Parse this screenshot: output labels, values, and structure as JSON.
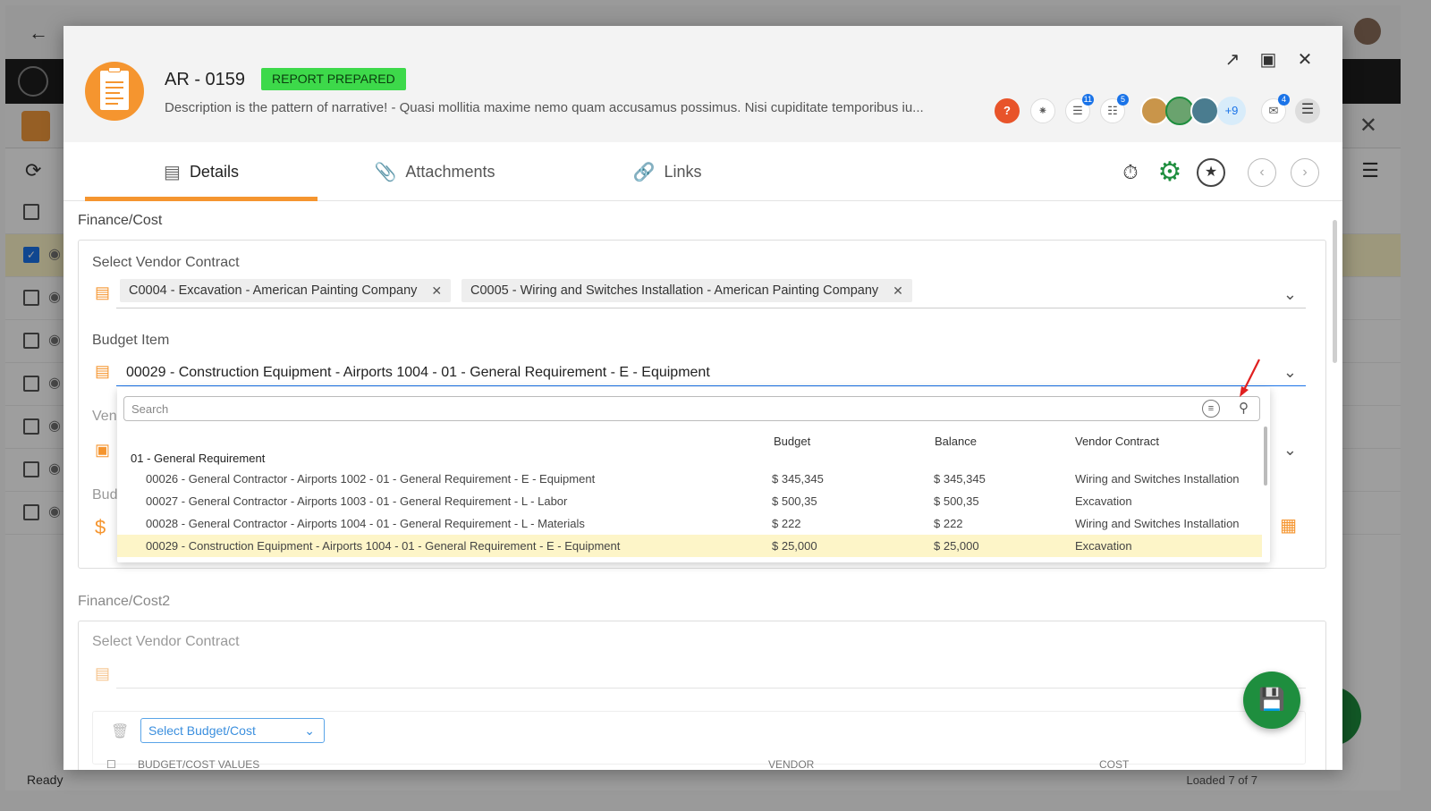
{
  "background": {
    "status": "Ready",
    "loaded": "Loaded 7 of 7"
  },
  "modal": {
    "record_id": "AR - 0159",
    "status_badge": "REPORT PREPARED",
    "description": "Description is the pattern of narrative!  - Quasi mollitia maxime nemo quam accusamus possimus. Nisi cupiditate temporibus iu...",
    "header_icons": {
      "help": "?",
      "notes_badge": "11",
      "tasks_badge": "5",
      "comments_badge": "4",
      "more_users": "+9"
    },
    "tabs": [
      {
        "label": "Details",
        "icon": "details-icon"
      },
      {
        "label": "Attachments",
        "icon": "paperclip-icon"
      },
      {
        "label": "Links",
        "icon": "link-icon"
      }
    ]
  },
  "finance": {
    "title": "Finance/Cost",
    "vendor_contract_label": "Select Vendor Contract",
    "chips": [
      "C0004 - Excavation - American Painting Company",
      "C0005 - Wiring and Switches Installation - American Painting Company"
    ],
    "budget_item_label": "Budget Item",
    "budget_item_value": "00029 - Construction Equipment - Airports 1004 - 01 - General Requirement - E - Equipment",
    "partial_vendor_label": "Ven",
    "partial_budget_label": "Bud"
  },
  "dropdown": {
    "search_placeholder": "Search",
    "columns": {
      "budget": "Budget",
      "balance": "Balance",
      "vendor_contract": "Vendor Contract"
    },
    "group": "01 - General Requirement",
    "rows": [
      {
        "name": "00026 - General Contractor - Airports 1002 - 01 - General Requirement - E - Equipment",
        "budget": "$ 345,345",
        "balance": "$ 345,345",
        "vendor": "Wiring and Switches Installation"
      },
      {
        "name": "00027 - General Contractor - Airports 1003 - 01 - General Requirement - L - Labor",
        "budget": "$ 500,35",
        "balance": "$ 500,35",
        "vendor": "Excavation"
      },
      {
        "name": "00028 - General Contractor - Airports 1004 - 01 - General Requirement - L - Materials",
        "budget": "$ 222",
        "balance": "$ 222",
        "vendor": "Wiring and Switches Installation"
      },
      {
        "name": "00029 - Construction Equipment - Airports 1004 - 01 - General Requirement - E - Equipment",
        "budget": "$ 25,000",
        "balance": "$ 25,000",
        "vendor": "Excavation"
      }
    ]
  },
  "finance2": {
    "title": "Finance/Cost2",
    "vendor_contract_label": "Select Vendor Contract",
    "select_budget_placeholder": "Select Budget/Cost",
    "col_values": "BUDGET/COST VALUES",
    "col_vendor": "VENDOR",
    "col_cost": "COST"
  },
  "colors": {
    "accent": "#f5952f",
    "status_green": "#3dd94a",
    "primary_green": "#1e8e3e",
    "link_blue": "#1a73e8",
    "selected_row": "#fdf5c8"
  }
}
